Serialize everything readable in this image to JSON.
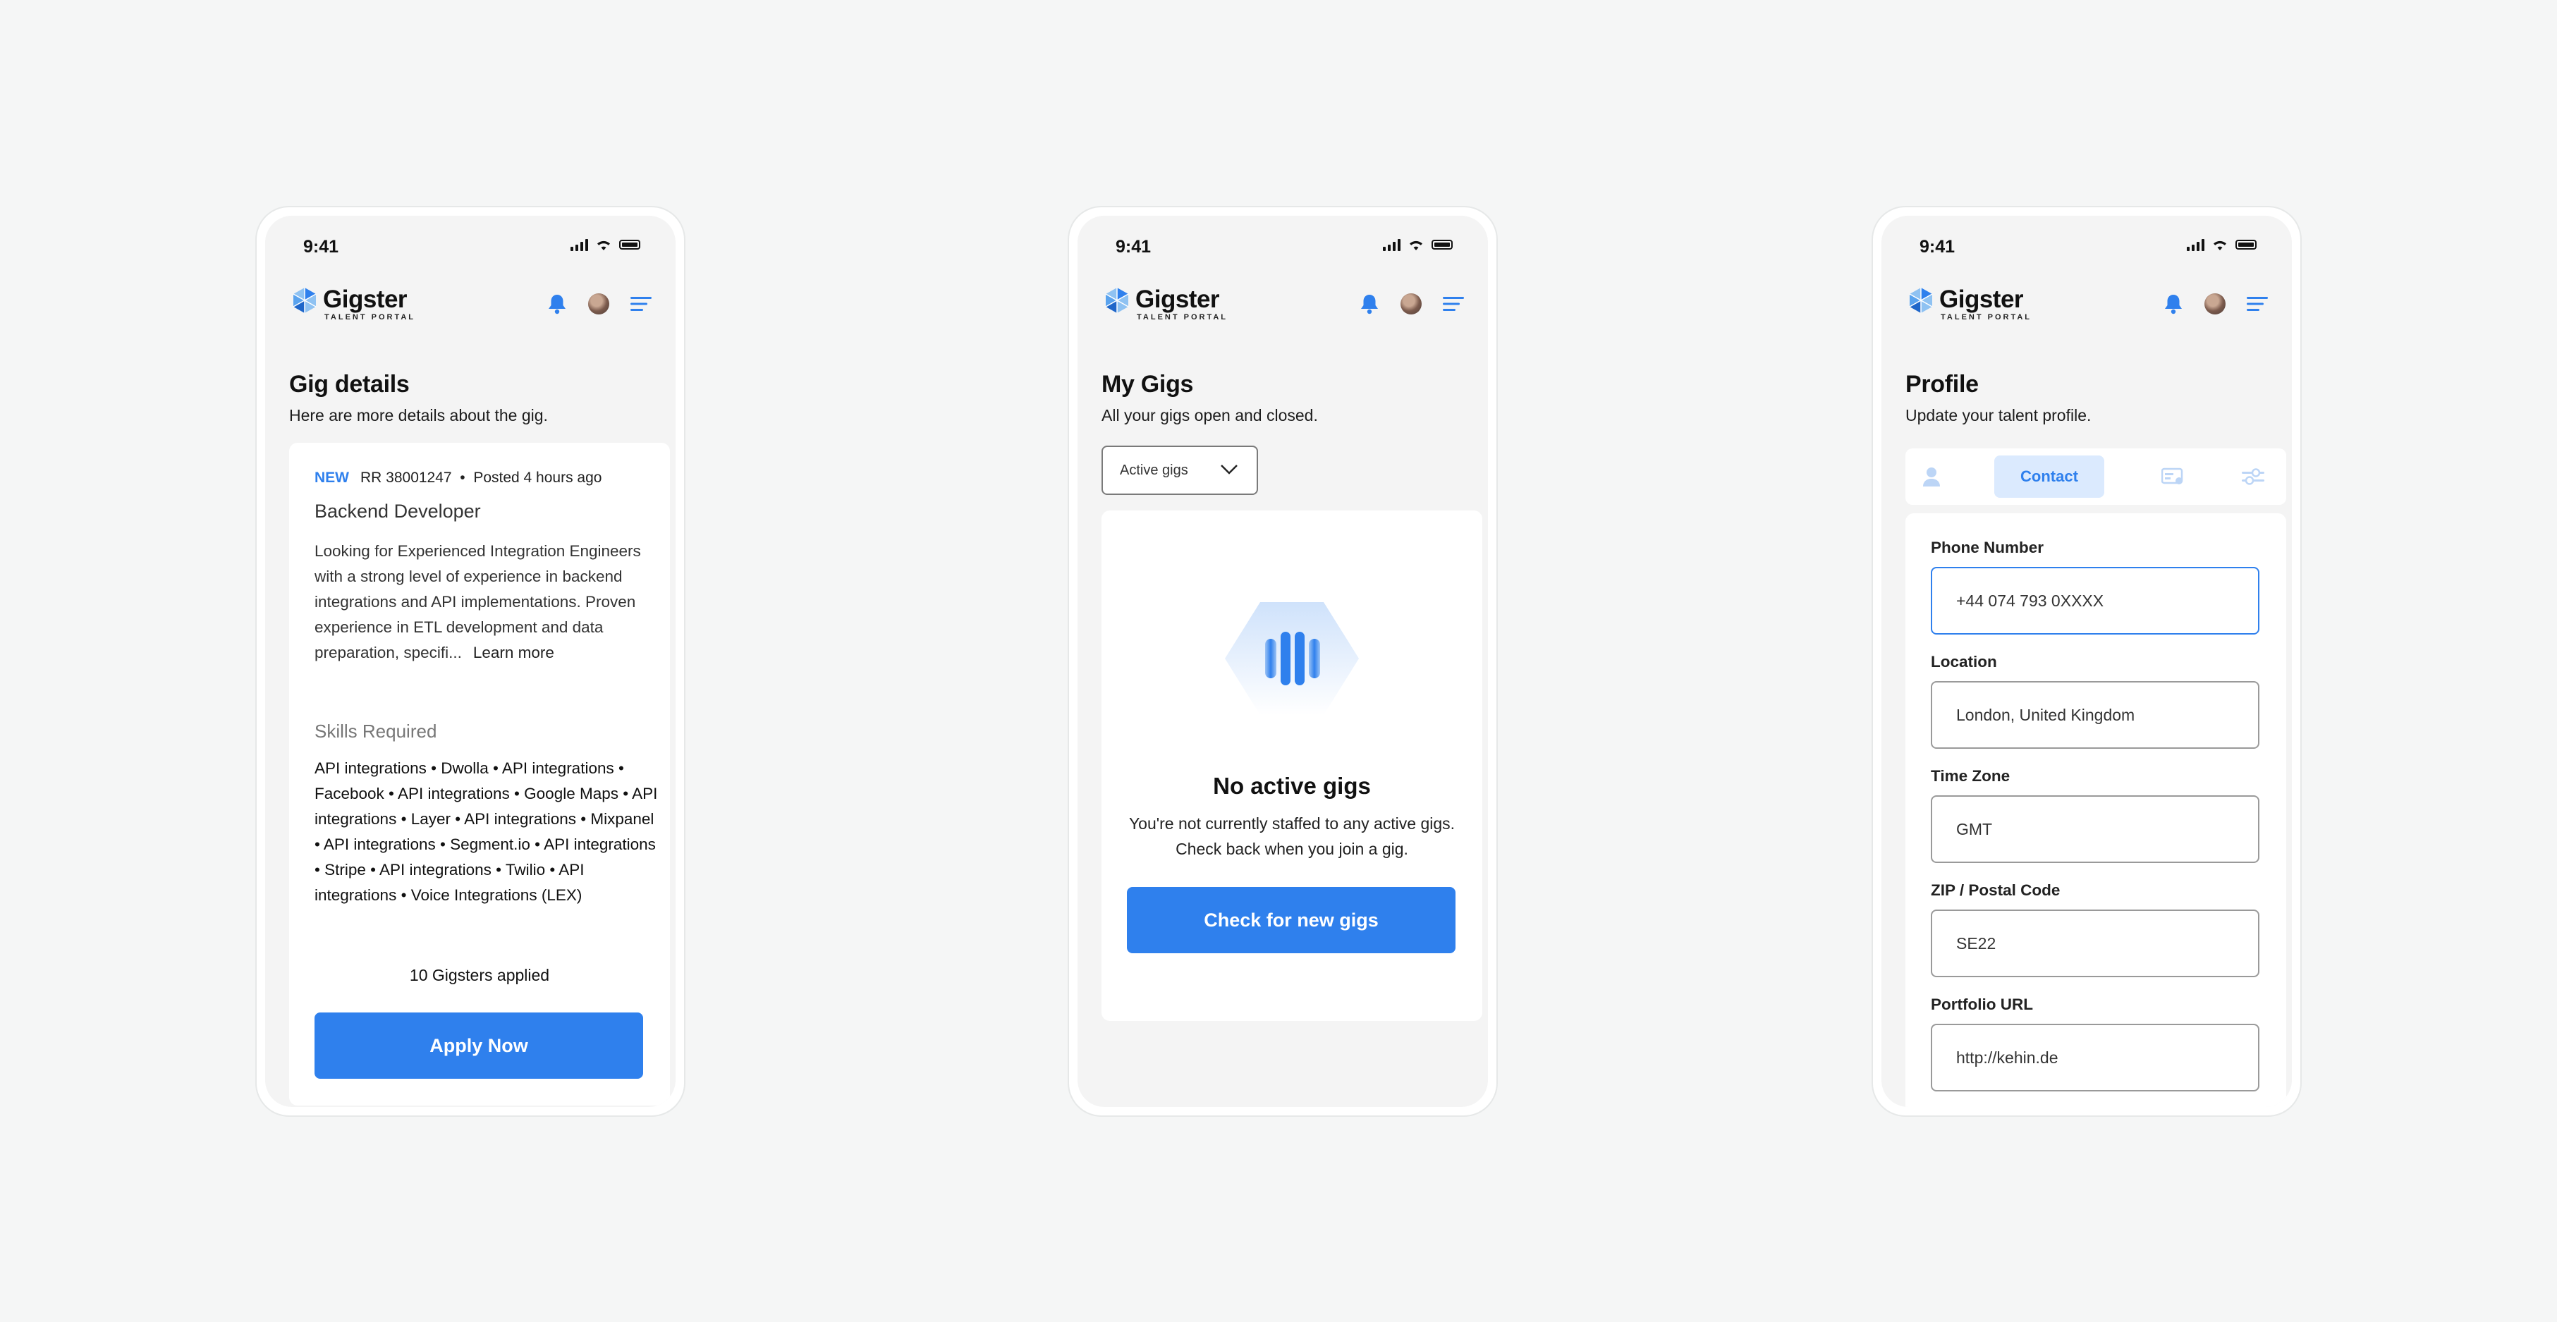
{
  "status": {
    "time": "9:41"
  },
  "brand": {
    "name": "Gigster",
    "tagline": "TALENT PORTAL"
  },
  "colors": {
    "accent": "#2f80ed",
    "background": "#f5f6f6",
    "card": "#ffffff"
  },
  "gig_details": {
    "title": "Gig details",
    "subtitle": "Here are more details about the gig.",
    "badge": "NEW",
    "ref": "RR 38001247",
    "posted": "Posted 4 hours ago",
    "role": "Backend Developer",
    "description": "Looking for Experienced Integration Engineers with a strong level of experience in backend integrations and API implementations. Proven experience in ETL development and data preparation, specifi...",
    "learn_more": "Learn more",
    "skills_heading": "Skills Required",
    "skills": "API integrations • Dwolla • API integrations • Facebook • API integrations • Google Maps • API integrations • Layer • API integrations • Mixpanel • API integrations • Segment.io • API integrations • Stripe • API integrations • Twilio • API integrations • Voice Integrations (LEX)",
    "applied": "10 Gigsters applied",
    "apply_button": "Apply Now"
  },
  "my_gigs": {
    "title": "My Gigs",
    "subtitle": "All your gigs open and closed.",
    "filter_selected": "Active gigs",
    "empty_title": "No active gigs",
    "empty_line1": "You're not currently staffed to any active gigs.",
    "empty_line2": "Check back when you join a gig.",
    "check_button": "Check for new gigs"
  },
  "profile": {
    "title": "Profile",
    "subtitle": "Update your talent profile.",
    "active_tab": "Contact",
    "fields": [
      {
        "label": "Phone Number",
        "value": "+44 074 793 0XXXX"
      },
      {
        "label": "Location",
        "value": "London, United Kingdom"
      },
      {
        "label": "Time Zone",
        "value": "GMT"
      },
      {
        "label": "ZIP / Postal Code",
        "value": "SE22"
      },
      {
        "label": "Portfolio URL",
        "value": "http://kehin.de"
      }
    ]
  }
}
